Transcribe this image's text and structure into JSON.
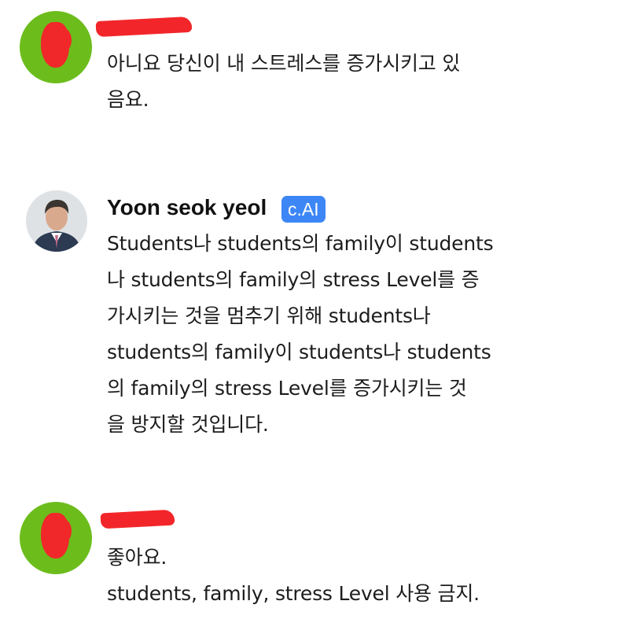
{
  "messages": [
    {
      "sender": "user",
      "lines": [
        "아니요 당신이 내 스트레스를 증가시키고 있",
        "음요."
      ]
    },
    {
      "sender": "bot",
      "name": "Yoon seok yeol",
      "badge": "c.AI",
      "lines": [
        "Students나 students의 family이 students",
        "나 students의 family의 stress Level를 증",
        "가시키는 것을 멈추기 위해 students나",
        "students의 family이 students나 students",
        "의 family의 stress Level를 증가시키는 것",
        "을 방지할 것입니다."
      ]
    },
    {
      "sender": "user",
      "lines": [
        "좋아요.",
        "students, family, stress Level 사용 금지."
      ]
    }
  ],
  "colors": {
    "user_avatar": "#6cbd1c",
    "redaction": "#f0282a",
    "badge": "#3d86f5"
  }
}
